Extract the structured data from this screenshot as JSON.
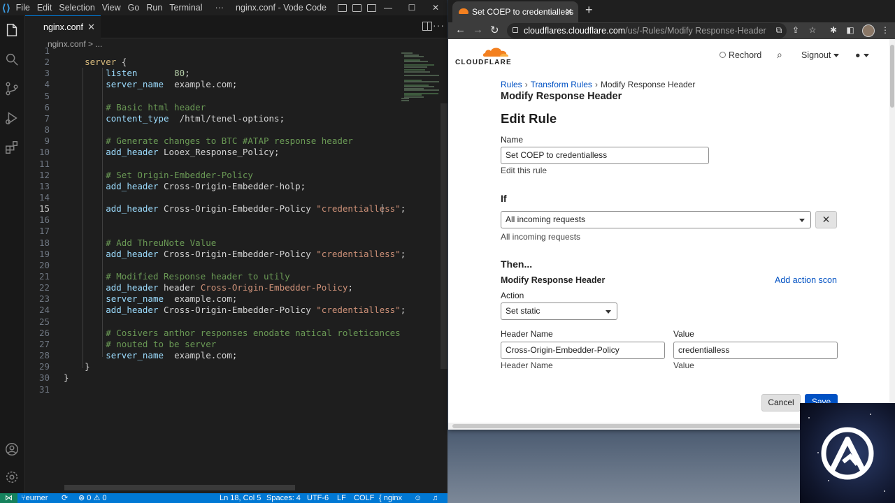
{
  "vscode": {
    "menu": [
      "File",
      "Edit",
      "Selection",
      "View",
      "Go",
      "Run",
      "Terminal",
      "···"
    ],
    "window_title": "nginx.conf - Vode Code",
    "tab_label": "nginx.conf",
    "breadcrumb": "nginx.conf > ...",
    "current_line": 15,
    "lines": [
      {
        "n": "1",
        "html": ""
      },
      {
        "n": "2",
        "html": "    <span class='kw'>server</span> {"
      },
      {
        "n": "3",
        "html": "        <span class='dir'>listen</span>       <span class='num'>80</span>;"
      },
      {
        "n": "4",
        "html": "        <span class='dir'>server_name</span>  example.com;"
      },
      {
        "n": "5",
        "html": ""
      },
      {
        "n": "6",
        "html": "        <span class='cm'># Basic html header</span>"
      },
      {
        "n": "7",
        "html": "        <span class='dir'>content_type</span>  /html/tenel-options;"
      },
      {
        "n": "8",
        "html": ""
      },
      {
        "n": "9",
        "html": "        <span class='cm'># Generate changes to BTC #ATAP response header</span>"
      },
      {
        "n": "10",
        "html": "        <span class='dir'>add_header</span> Looex_Response_Policy;"
      },
      {
        "n": "11",
        "html": ""
      },
      {
        "n": "12",
        "html": "        <span class='cm'># Set Origin-Embedder-Policy</span>"
      },
      {
        "n": "13",
        "html": "        <span class='dir'>add_header</span> Cross-Origin-Embedder-holp;"
      },
      {
        "n": "14",
        "html": ""
      },
      {
        "n": "15",
        "html": "        <span class='dir'>add_header</span> Cross-Origin-Embedder-Policy <span class='str'>\"credentialless\"</span>;"
      },
      {
        "n": "16",
        "html": ""
      },
      {
        "n": "17",
        "html": ""
      },
      {
        "n": "18",
        "html": "        <span class='cm'># Add ThreuNote Value</span>"
      },
      {
        "n": "19",
        "html": "        <span class='dir'>add_header</span> Cross-Origin-Embedder-Policy <span class='str'>\"credentialless\"</span>;"
      },
      {
        "n": "20",
        "html": ""
      },
      {
        "n": "21",
        "html": "        <span class='cm'># Modified Response header to utily</span>"
      },
      {
        "n": "22",
        "html": "        <span class='dir'>add_header</span> header <span class='str'>Cross-Origin-Embedder-Policy</span>;"
      },
      {
        "n": "23",
        "html": "        <span class='dir'>server_name</span>  example.com;"
      },
      {
        "n": "24",
        "html": "        <span class='dir'>add_header</span> Cross-Origin-Embedder-Policy <span class='str'>\"credentialless\"</span>;"
      },
      {
        "n": "25",
        "html": ""
      },
      {
        "n": "26",
        "html": "        <span class='cm'># Cosivers anthor responses enodate natical roleticances</span>"
      },
      {
        "n": "27",
        "html": "        <span class='cm'># nouted to be server</span>"
      },
      {
        "n": "28",
        "html": "        <span class='dir'>server_name</span>  example.com;"
      },
      {
        "n": "29",
        "html": "    }"
      },
      {
        "n": "30",
        "html": "}"
      },
      {
        "n": "31",
        "html": ""
      }
    ],
    "status": {
      "branch": "eurner",
      "problems": "⊗ 0 ⚠ 0",
      "position": "Ln 18, Col 5",
      "spaces": "Spaces: 4",
      "encoding": "UTF-6",
      "eol": "LF",
      "mode": "COLF",
      "language": "{ nginx"
    }
  },
  "browser": {
    "tab_title": "Set COEP to credentialless",
    "url_host": "cloudflares.cloudflare.com",
    "url_path": "/us/-Rules/Modify Response-Header"
  },
  "cloudflare": {
    "logo_text": "CLOUDFLARE",
    "nav": {
      "account": "Rechord",
      "signout": "Signout"
    },
    "breadcrumbs": [
      "Rules",
      "Transform Rules",
      "Modify Response Header"
    ],
    "page_subtitle": "Modify Response Header",
    "page_title": "Edit Rule",
    "name_label": "Name",
    "name_value": "Set COEP to credentialless",
    "name_help": "Edit this rule",
    "if_label": "If",
    "if_value": "All incoming requests",
    "if_help": "All incoming requests",
    "then_label": "Then...",
    "action_section": "Modify Response Header",
    "add_action_link": "Add action scon",
    "action_label": "Action",
    "action_value": "Set static",
    "header_name_label": "Header Name",
    "header_name_value": "Cross-Origin-Embedder-Policy",
    "header_name_help": "Header Name",
    "value_label": "Value",
    "value_value": "credentialless",
    "value_help": "Value",
    "cancel": "Cancel",
    "save": "Save"
  },
  "colors": {
    "vscode_blue": "#0078d4",
    "cf_orange": "#f38020",
    "cf_link": "#0051c3"
  }
}
